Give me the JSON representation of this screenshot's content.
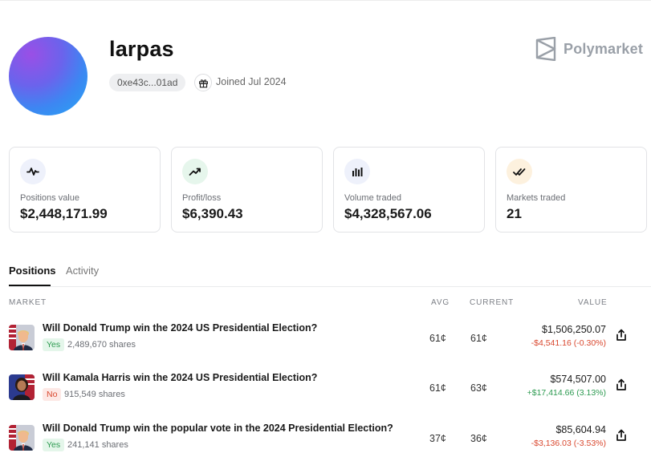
{
  "profile": {
    "username": "larpas",
    "address": "0xe43c...01ad",
    "joined": "Joined Jul 2024",
    "avatar_colors": [
      "#9a4fe6",
      "#3d86f2",
      "#25a7f4"
    ]
  },
  "brand": {
    "name": "Polymarket",
    "icon": "polymarket-logo-icon",
    "color": "#9aa0a8"
  },
  "stats": [
    {
      "label": "Positions value",
      "value": "$2,448,171.99",
      "icon": "activity-pulse-icon",
      "bg": "#eef1fb"
    },
    {
      "label": "Profit/loss",
      "value": "$6,390.43",
      "icon": "trending-up-icon",
      "bg": "#e6f6ec"
    },
    {
      "label": "Volume traded",
      "value": "$4,328,567.06",
      "icon": "bar-chart-icon",
      "bg": "#eef1fb"
    },
    {
      "label": "Markets traded",
      "value": "21",
      "icon": "double-check-icon",
      "bg": "#fdf1de"
    }
  ],
  "tabs": [
    {
      "label": "Positions",
      "active": true
    },
    {
      "label": "Activity",
      "active": false
    }
  ],
  "table": {
    "headers": {
      "market": "MARKET",
      "avg": "AVG",
      "current": "CURRENT",
      "value": "VALUE"
    },
    "rows": [
      {
        "question": "Will Donald Trump win the 2024 US Presidential Election?",
        "outcome": "Yes",
        "shares": "2,489,670 shares",
        "avg": "61¢",
        "current": "61¢",
        "value": "$1,506,250.07",
        "pnl": "-$4,541.16 (-0.30%)",
        "pnl_sign": "negative",
        "thumb": "trump-thumbnail"
      },
      {
        "question": "Will Kamala Harris win the 2024 US Presidential Election?",
        "outcome": "No",
        "shares": "915,549 shares",
        "avg": "61¢",
        "current": "63¢",
        "value": "$574,507.00",
        "pnl": "+$17,414.66 (3.13%)",
        "pnl_sign": "positive",
        "thumb": "harris-thumbnail"
      },
      {
        "question": "Will Donald Trump win the popular vote in the 2024 Presidential Election?",
        "outcome": "Yes",
        "shares": "241,141 shares",
        "avg": "37¢",
        "current": "36¢",
        "value": "$85,604.94",
        "pnl": "-$3,136.03 (-3.53%)",
        "pnl_sign": "negative",
        "thumb": "trump-thumbnail"
      }
    ]
  }
}
